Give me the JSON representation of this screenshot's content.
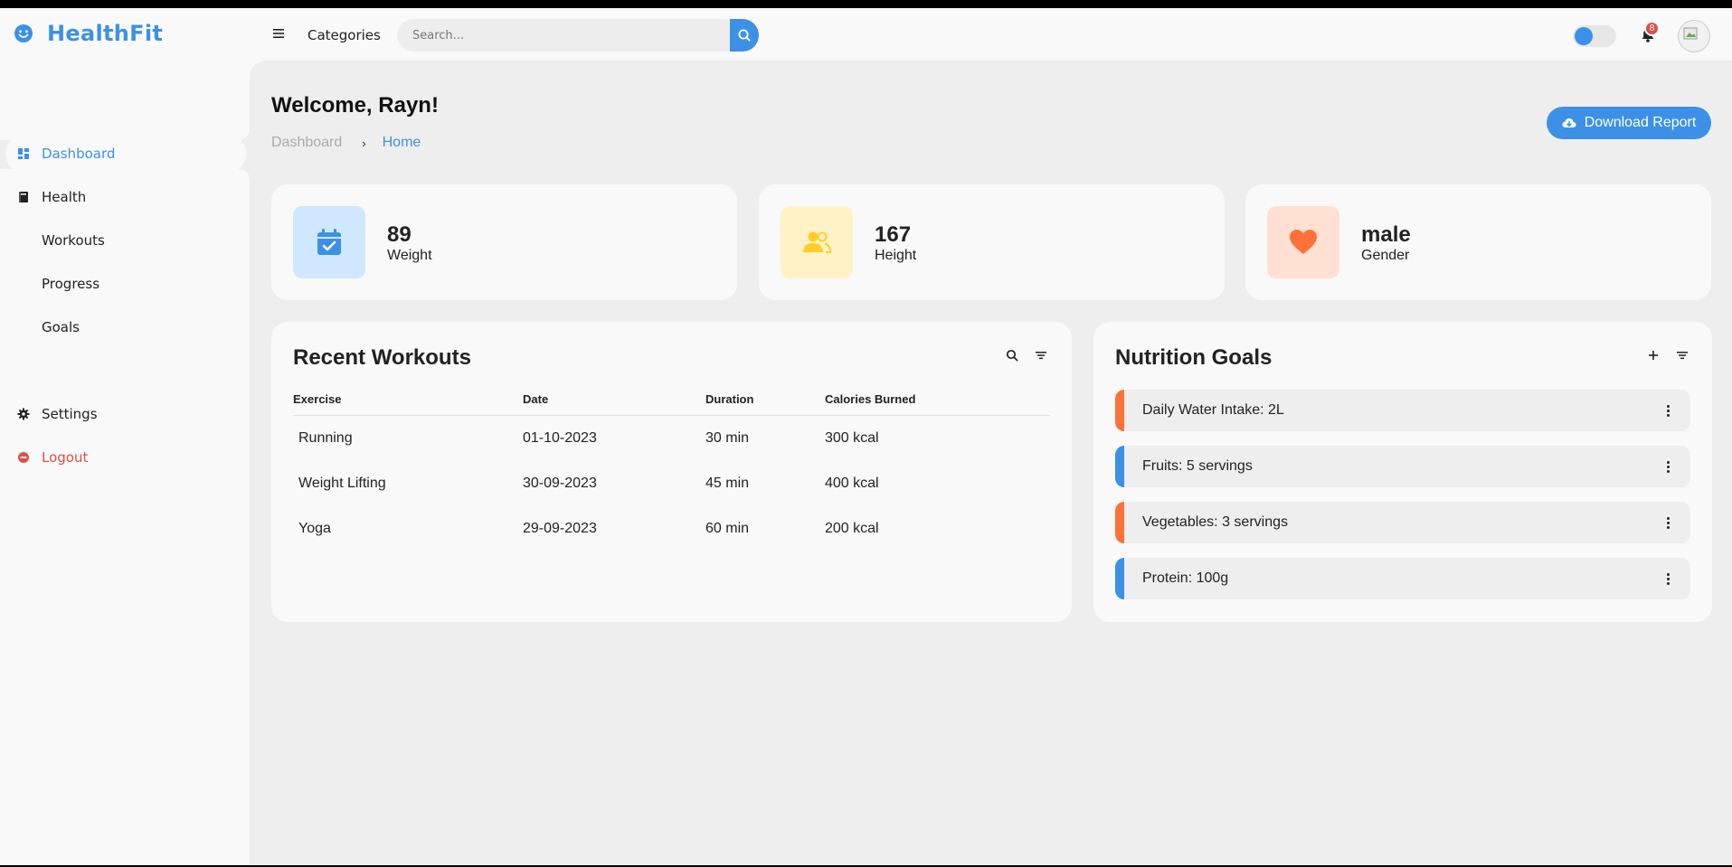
{
  "app": {
    "name": "HealthFit"
  },
  "topbar": {
    "categories_label": "Categories",
    "search_placeholder": "Search...",
    "notification_count": "8",
    "theme_toggle_on": false
  },
  "sidebar": {
    "items": [
      {
        "label": "Dashboard",
        "icon": "dashboard-icon",
        "active": true
      },
      {
        "label": "Health",
        "icon": "book-icon"
      },
      {
        "label": "Workouts",
        "icon": ""
      },
      {
        "label": "Progress",
        "icon": ""
      },
      {
        "label": "Goals",
        "icon": ""
      }
    ],
    "bottom_items": [
      {
        "label": "Settings",
        "icon": "gear-icon"
      },
      {
        "label": "Logout",
        "icon": "logout-icon"
      }
    ]
  },
  "header": {
    "welcome": "Welcome, Rayn!",
    "breadcrumb": [
      "Dashboard",
      "Home"
    ],
    "download_label": "Download Report"
  },
  "stats": [
    {
      "value": "89",
      "label": "Weight",
      "icon": "calendar-check-icon",
      "bg": "#cfe8ff",
      "fg": "#3c91e6"
    },
    {
      "value": "167",
      "label": "Height",
      "icon": "people-icon",
      "bg": "#fff2c6",
      "fg": "#ffce26"
    },
    {
      "value": "male",
      "label": "Gender",
      "icon": "heart-icon",
      "bg": "#ffe0d3",
      "fg": "#fd7238"
    }
  ],
  "workouts": {
    "title": "Recent Workouts",
    "columns": [
      "Exercise",
      "Date",
      "Duration",
      "Calories Burned"
    ],
    "rows": [
      [
        "Running",
        "01-10-2023",
        "30 min",
        "300 kcal"
      ],
      [
        "Weight Lifting",
        "30-09-2023",
        "45 min",
        "400 kcal"
      ],
      [
        "Yoga",
        "29-09-2023",
        "60 min",
        "200 kcal"
      ]
    ]
  },
  "nutrition": {
    "title": "Nutrition Goals",
    "goals": [
      {
        "text": "Daily Water Intake: 2L",
        "accent": "orange"
      },
      {
        "text": "Fruits: 5 servings",
        "accent": "blue"
      },
      {
        "text": "Vegetables: 3 servings",
        "accent": "orange"
      },
      {
        "text": "Protein: 100g",
        "accent": "blue"
      }
    ]
  },
  "colors": {
    "accent": "#3c91e6",
    "orange": "#fd7238",
    "danger": "#db504a"
  }
}
